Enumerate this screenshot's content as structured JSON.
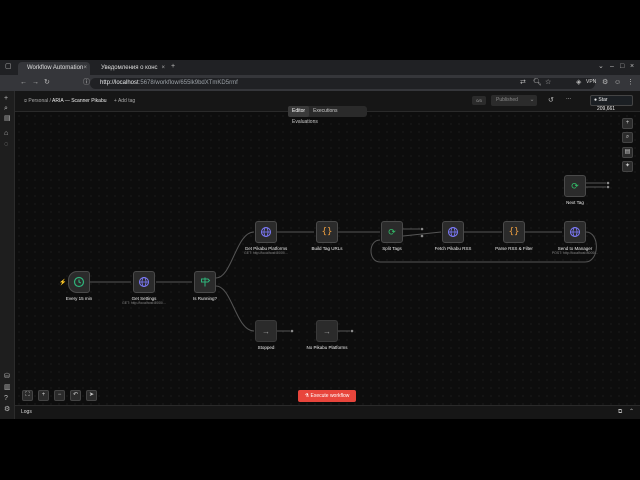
{
  "browser": {
    "tabs": [
      {
        "label": "Workflow Automation"
      },
      {
        "label": "Уведомления о конс"
      }
    ],
    "url_host": "http://localhost",
    "url_rest": ":5678/workflow/655lk9bdXTmKD5rmf",
    "vpn_label": "VPN"
  },
  "header": {
    "breadcrumb_personal": "Personal",
    "breadcrumb_sep": "/",
    "workflow_name": "ARIA — Scanner Pikabu",
    "add_tag": "+ Add tag",
    "counter": "0/3",
    "publish_label": "Published",
    "more": "...",
    "github_star": "Star",
    "star_count": "209,661"
  },
  "editor_tabs": [
    "Editor",
    "Executions",
    "Evaluations"
  ],
  "nodes": [
    {
      "label": "Every 15 min",
      "sub": ""
    },
    {
      "label": "Get Settings",
      "sub": "GET: http://localhost:8000/..."
    },
    {
      "label": "Is Running?",
      "sub": ""
    },
    {
      "label": "Get Pikabu Platforms",
      "sub": "GET: http://localhost:8000/..."
    },
    {
      "label": "Build Tag URLs",
      "sub": ""
    },
    {
      "label": "Split Tags",
      "sub": ""
    },
    {
      "label": "Fetch Pikabu RSS",
      "sub": ""
    },
    {
      "label": "Parse RSS & Filter",
      "sub": ""
    },
    {
      "label": "Send to Manager",
      "sub": "POST: http://localhost:8000/..."
    },
    {
      "label": "Next Tag",
      "sub": ""
    },
    {
      "label": "Stopped",
      "sub": ""
    },
    {
      "label": "No Pikabu Platforms",
      "sub": ""
    }
  ],
  "execute_button": "Execute workflow",
  "logs_label": "Logs",
  "icons": {
    "trigger": "clock-icon",
    "http": "globe-icon",
    "code": "braces-icon",
    "if": "signpost-icon",
    "split": "refresh-icon"
  },
  "colors": {
    "execute": "#e8453c",
    "trigger_green": "#2fb37a",
    "http_purple": "#7f7cff",
    "code_orange": "#f0a040",
    "loop_green": "#33c36b"
  }
}
